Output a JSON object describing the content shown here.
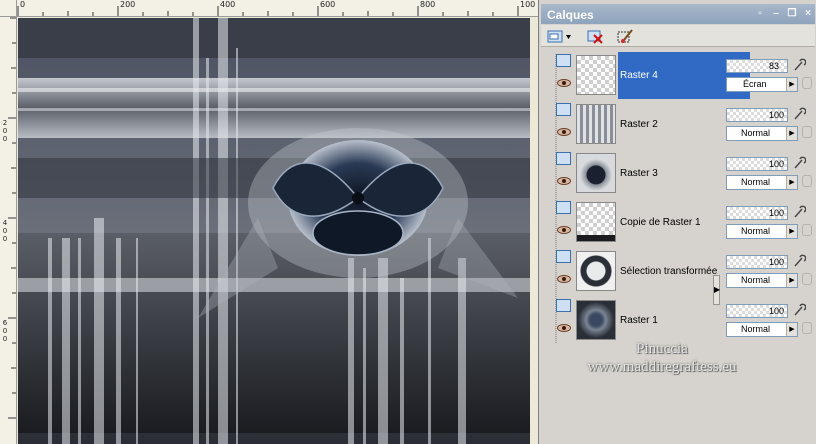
{
  "rulers": {
    "top_labels": [
      "0",
      "200",
      "400",
      "600",
      "800",
      "100"
    ],
    "left_labels": [
      "2",
      "0",
      "0",
      "4",
      "0",
      "0",
      "6",
      "0",
      "0"
    ]
  },
  "palette": {
    "title": "Calques",
    "layers": [
      {
        "name": "Raster 4",
        "opacity": "83",
        "blend": "Écran",
        "selected": true
      },
      {
        "name": "Raster 2",
        "opacity": "100",
        "blend": "Normal",
        "selected": false
      },
      {
        "name": "Raster 3",
        "opacity": "100",
        "blend": "Normal",
        "selected": false
      },
      {
        "name": "Copie de Raster 1",
        "opacity": "100",
        "blend": "Normal",
        "selected": false
      },
      {
        "name": "Sélection transformée",
        "opacity": "100",
        "blend": "Normal",
        "selected": false
      },
      {
        "name": "Raster 1",
        "opacity": "100",
        "blend": "Normal",
        "selected": false
      }
    ]
  },
  "watermark": [
    "Pinuccia",
    "www.maddiregraftess.eu"
  ],
  "icons": [
    "new-layer-icon",
    "dropdown-icon",
    "delete-layer-icon",
    "brush-edit-icon",
    "eye-icon",
    "layer-type-icon",
    "lock-icon",
    "link-icon",
    "minimize-icon",
    "restore-icon",
    "close-icon",
    "pin-icon"
  ]
}
